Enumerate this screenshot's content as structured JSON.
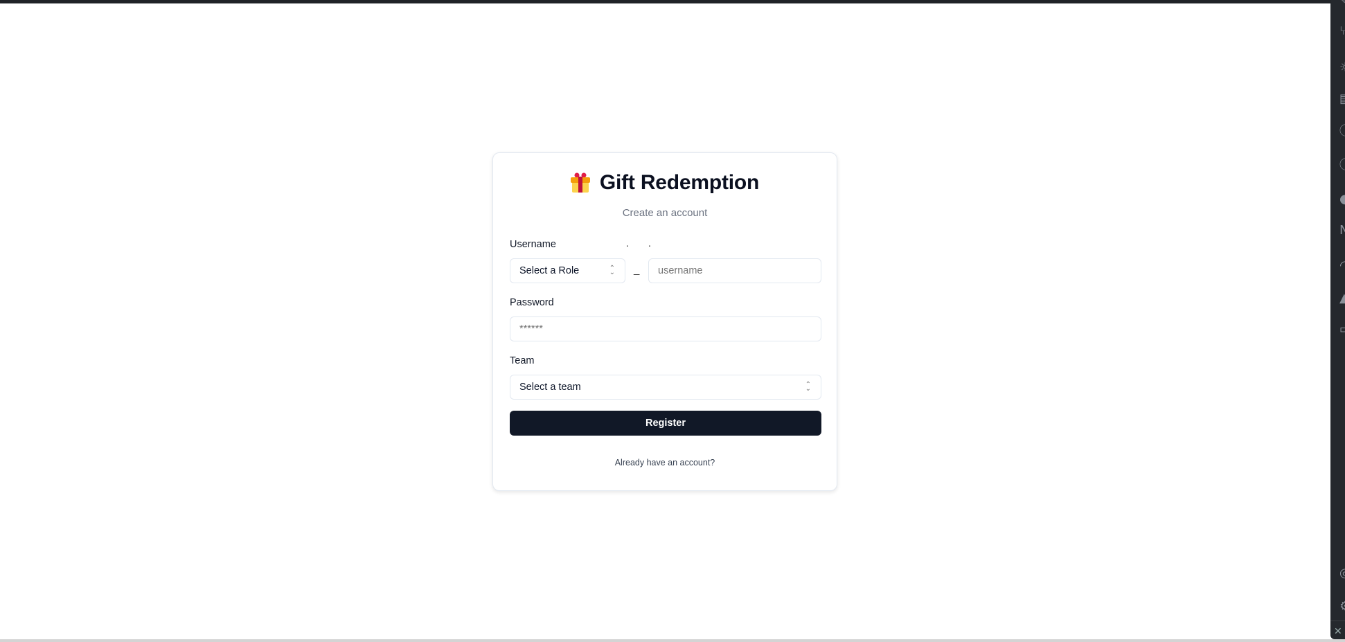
{
  "app": {
    "title": "Gift Redemption",
    "subtitle": "Create an account"
  },
  "form": {
    "username_label": "Username",
    "dots": [
      ".",
      "."
    ],
    "role_select": {
      "value": "Select a Role"
    },
    "separator": "_",
    "username_input": {
      "placeholder": "username",
      "value": ""
    },
    "password_label": "Password",
    "password_input": {
      "placeholder": "******",
      "value": ""
    },
    "team_label": "Team",
    "team_select": {
      "value": "Select a team"
    },
    "register_label": "Register",
    "login_link": "Already have an account?"
  },
  "colors": {
    "primary_button": "#111827",
    "sidebar": "#25282d"
  },
  "sidebar_icons": [
    "pencil-icon",
    "git-branch-icon",
    "debug-icon",
    "layout-icon",
    "info-icon",
    "info-icon",
    "docker-icon",
    "n-icon",
    "wifi-icon",
    "a-icon",
    "comment-icon",
    "account-icon",
    "settings-icon",
    "close-icon"
  ]
}
